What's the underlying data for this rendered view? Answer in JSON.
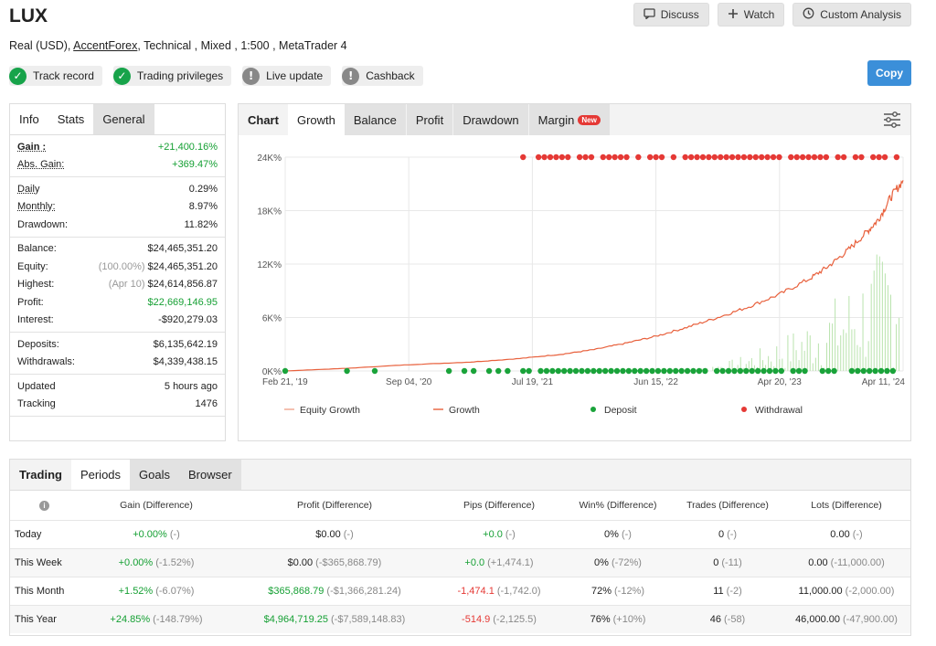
{
  "header": {
    "title": "LUX",
    "actions": [
      {
        "icon": "chat-icon",
        "label": "Discuss"
      },
      {
        "icon": "plus-icon",
        "label": "Watch"
      },
      {
        "icon": "clock-icon",
        "label": "Custom Analysis"
      }
    ],
    "subline_prefix": "Real (USD),",
    "broker": "AccentForex",
    "subline_suffix": ", Technical , Mixed , 1:500 , MetaTrader 4",
    "copy_label": "Copy"
  },
  "badges": [
    {
      "label": "Track record",
      "status": "ok"
    },
    {
      "label": "Trading privileges",
      "status": "ok"
    },
    {
      "label": "Live update",
      "status": "warn"
    },
    {
      "label": "Cashback",
      "status": "warn"
    }
  ],
  "stats_panel": {
    "tabs": [
      "Info",
      "Stats",
      "General"
    ],
    "groups": [
      [
        {
          "label": "Gain :",
          "value": "+21,400.16%",
          "green": true
        },
        {
          "label": "Abs. Gain:",
          "value": "+369.47%",
          "green": true
        }
      ],
      [
        {
          "label": "Daily",
          "value": "0.29%"
        },
        {
          "label": "Monthly:",
          "value": "8.97%"
        },
        {
          "label": "Drawdown:",
          "value": "11.82%"
        }
      ],
      [
        {
          "label": "Balance:",
          "value": "$24,465,351.20"
        },
        {
          "label": "Equity:",
          "value": "$24,465,351.20",
          "prefix": "(100.00%)"
        },
        {
          "label": "Highest:",
          "value": "$24,614,856.87",
          "prefix": "(Apr 10)"
        },
        {
          "label": "Profit:",
          "value": "$22,669,146.95",
          "green": true
        },
        {
          "label": "Interest:",
          "value": "-$920,279.03"
        }
      ],
      [
        {
          "label": "Deposits:",
          "value": "$6,135,642.19"
        },
        {
          "label": "Withdrawals:",
          "value": "$4,339,438.15"
        }
      ],
      [
        {
          "label": "Updated",
          "value": "5 hours ago"
        },
        {
          "label": "Tracking",
          "value": "1476"
        }
      ]
    ]
  },
  "chart_panel": {
    "tabs": [
      "Chart",
      "Growth",
      "Balance",
      "Profit",
      "Drawdown",
      "Margin"
    ],
    "new_badge": "New",
    "settings_icon": "sliders-icon"
  },
  "chart_data": {
    "type": "line",
    "title": "",
    "x_tick_labels": [
      "Feb 21, '19",
      "Sep 04, '20",
      "Jul 19, '21",
      "Jun 15, '22",
      "Apr 20, '23",
      "Apr 11, '24"
    ],
    "y_tick_labels": [
      "0K%",
      "6K%",
      "12K%",
      "18K%",
      "24K%"
    ],
    "ylim": [
      0,
      24000
    ],
    "grid": true,
    "legend_position": "bottom",
    "legend": [
      "Equity Growth",
      "Growth",
      "Deposit",
      "Withdrawal"
    ],
    "series": [
      {
        "name": "Growth",
        "color": "#e8603c",
        "x": [
          0,
          0.1,
          0.2,
          0.3,
          0.38,
          0.45,
          0.5,
          0.55,
          0.6,
          0.65,
          0.7,
          0.75,
          0.8,
          0.85,
          0.88,
          0.91,
          0.94,
          0.96,
          0.98,
          1.0
        ],
        "values": [
          0,
          300,
          700,
          1000,
          1400,
          1900,
          2400,
          3100,
          3900,
          4900,
          6000,
          7200,
          8600,
          10400,
          11800,
          13500,
          15500,
          17000,
          19500,
          21400
        ]
      }
    ],
    "deposit_color": "#1aa33a",
    "withdrawal_color": "#e53935",
    "bar_color": "#b9e3ad"
  },
  "bottom_panel": {
    "tabs": [
      "Trading",
      "Periods",
      "Goals",
      "Browser"
    ],
    "columns": [
      "Gain (Difference)",
      "Profit (Difference)",
      "Pips (Difference)",
      "Win% (Difference)",
      "Trades (Difference)",
      "Lots (Difference)"
    ],
    "rows": [
      {
        "label": "Today",
        "cells": [
          {
            "v": "+0.00%",
            "d": "(-)",
            "c": "pos"
          },
          {
            "v": "$0.00",
            "d": "(-)",
            "c": ""
          },
          {
            "v": "+0.0",
            "d": "(-)",
            "c": "pos"
          },
          {
            "v": "0%",
            "d": "(-)",
            "c": ""
          },
          {
            "v": "0",
            "d": "(-)",
            "c": ""
          },
          {
            "v": "0.00",
            "d": "(-)",
            "c": ""
          }
        ]
      },
      {
        "label": "This Week",
        "cells": [
          {
            "v": "+0.00%",
            "d": "(-1.52%)",
            "c": "pos"
          },
          {
            "v": "$0.00",
            "d": "(-$365,868.79)",
            "c": ""
          },
          {
            "v": "+0.0",
            "d": "(+1,474.1)",
            "c": "pos"
          },
          {
            "v": "0%",
            "d": "(-72%)",
            "c": ""
          },
          {
            "v": "0",
            "d": "(-11)",
            "c": ""
          },
          {
            "v": "0.00",
            "d": "(-11,000.00)",
            "c": ""
          }
        ]
      },
      {
        "label": "This Month",
        "cells": [
          {
            "v": "+1.52%",
            "d": "(-6.07%)",
            "c": "pos"
          },
          {
            "v": "$365,868.79",
            "d": "(-$1,366,281.24)",
            "c": "pos"
          },
          {
            "v": "-1,474.1",
            "d": "(-1,742.0)",
            "c": "neg"
          },
          {
            "v": "72%",
            "d": "(-12%)",
            "c": ""
          },
          {
            "v": "11",
            "d": "(-2)",
            "c": ""
          },
          {
            "v": "11,000.00",
            "d": "(-2,000.00)",
            "c": ""
          }
        ]
      },
      {
        "label": "This Year",
        "cells": [
          {
            "v": "+24.85%",
            "d": "(-148.79%)",
            "c": "pos"
          },
          {
            "v": "$4,964,719.25",
            "d": "(-$7,589,148.83)",
            "c": "pos"
          },
          {
            "v": "-514.9",
            "d": "(-2,125.5)",
            "c": "neg"
          },
          {
            "v": "76%",
            "d": "(+10%)",
            "c": ""
          },
          {
            "v": "46",
            "d": "(-58)",
            "c": ""
          },
          {
            "v": "46,000.00",
            "d": "(-47,900.00)",
            "c": ""
          }
        ]
      }
    ]
  }
}
